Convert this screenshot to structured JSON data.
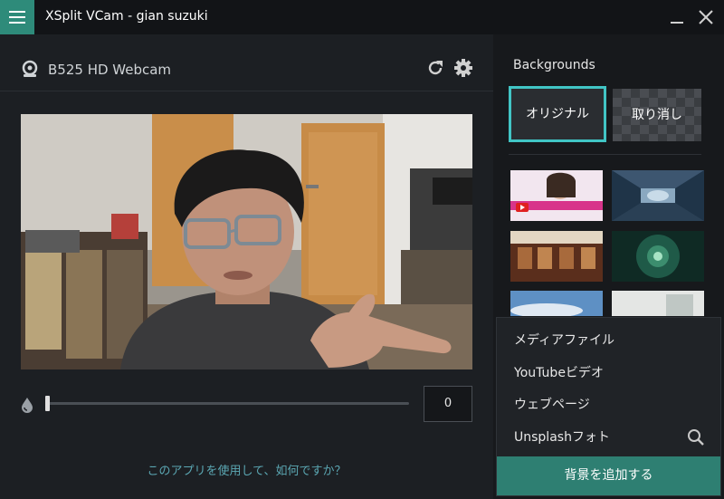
{
  "titlebar": {
    "title": "XSplit VCam - gian suzuki"
  },
  "camera": {
    "name": "B525 HD Webcam"
  },
  "blur": {
    "value": "0",
    "fraction": 0.0
  },
  "feedback": {
    "text": "このアプリを使用して、如何ですか？"
  },
  "backgrounds": {
    "title": "Backgrounds",
    "original_label": "オリジナル",
    "cancel_label": "取り消し"
  },
  "dropdown": {
    "items": [
      "メディアファイル",
      "YouTubeビデオ",
      "ウェブページ",
      "Unsplashフォト"
    ],
    "add_label": "背景を追加する"
  },
  "colors": {
    "accent": "#41c5c5",
    "menu_button": "#2e8b7a",
    "add_button": "#2e7f72",
    "link": "#5ba7b3"
  },
  "icons": [
    "hamburger-menu-icon",
    "minimize-icon",
    "close-icon",
    "webcam-icon",
    "refresh-icon",
    "gear-icon",
    "droplet-icon",
    "search-icon"
  ]
}
